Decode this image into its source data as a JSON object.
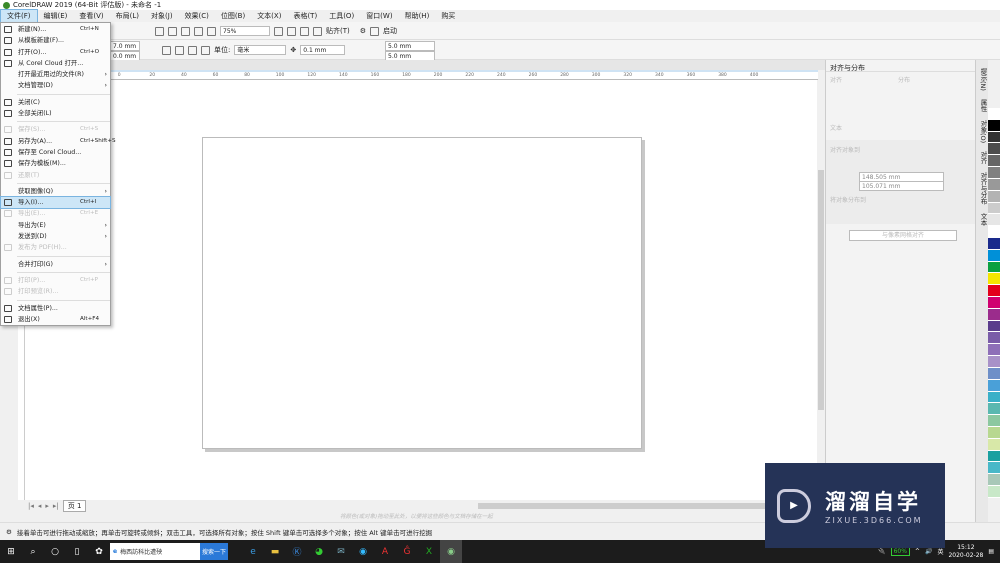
{
  "window": {
    "title": "CorelDRAW 2019 (64-Bit 评估版) - 未命名 -1"
  },
  "menubar": [
    "文件(F)",
    "编辑(E)",
    "查看(V)",
    "布局(L)",
    "对象(J)",
    "效果(C)",
    "位图(B)",
    "文本(X)",
    "表格(T)",
    "工具(O)",
    "窗口(W)",
    "帮助(H)",
    "购买"
  ],
  "toolbar": {
    "zoom": "75%",
    "snap": "贴齐(T)",
    "launch": "启动"
  },
  "propbar": {
    "width": "7.0 mm",
    "height": "0.0 mm",
    "unit_label": "单位:",
    "unit": "毫米",
    "nudge": "0.1 mm",
    "dup_x": "5.0 mm",
    "dup_y": "5.0 mm"
  },
  "ruler": [
    "-60",
    "-40",
    "-20",
    "0",
    "20",
    "40",
    "60",
    "80",
    "100",
    "120",
    "140",
    "160",
    "180",
    "200",
    "220",
    "240",
    "260",
    "280",
    "300",
    "320",
    "340",
    "360",
    "380",
    "400"
  ],
  "file_menu": [
    {
      "label": "新建(N)...",
      "shortcut": "Ctrl+N",
      "icon": "new-document-icon"
    },
    {
      "label": "从模板新建(F)...",
      "icon": "new-from-template-icon"
    },
    {
      "label": "打开(O)...",
      "shortcut": "Ctrl+O",
      "icon": "open-folder-icon"
    },
    {
      "label": "从 Corel Cloud 打开...",
      "icon": "cloud-icon"
    },
    {
      "label": "打开最近用过的文件(R)",
      "submenu": true
    },
    {
      "label": "文档管理(D)",
      "submenu": true
    },
    {
      "sep": true
    },
    {
      "label": "关闭(C)",
      "icon": "close-document-icon"
    },
    {
      "label": "全部关闭(L)",
      "icon": "close-all-icon"
    },
    {
      "sep": true
    },
    {
      "label": "保存(S)...",
      "shortcut": "Ctrl+S",
      "disabled": true,
      "icon": "save-icon"
    },
    {
      "label": "另存为(A)...",
      "shortcut": "Ctrl+Shift+S",
      "icon": "save-as-icon"
    },
    {
      "label": "保存至 Corel Cloud...",
      "icon": "cloud-upload-icon"
    },
    {
      "label": "保存为模板(M)...",
      "icon": "save-template-icon"
    },
    {
      "label": "还原(T)",
      "disabled": true,
      "icon": "revert-icon"
    },
    {
      "sep": true
    },
    {
      "label": "获取图像(Q)",
      "submenu": true
    },
    {
      "label": "导入(I)...",
      "shortcut": "Ctrl+I",
      "highlighted": true,
      "icon": "import-icon"
    },
    {
      "label": "导出(E)...",
      "shortcut": "Ctrl+E",
      "disabled": true,
      "icon": "export-icon"
    },
    {
      "label": "导出为(E)",
      "submenu": true
    },
    {
      "label": "发送到(D)",
      "submenu": true
    },
    {
      "label": "发布为 PDF(H)...",
      "disabled": true,
      "icon": "pdf-icon"
    },
    {
      "sep": true
    },
    {
      "label": "合并打印(G)",
      "submenu": true
    },
    {
      "sep": true
    },
    {
      "label": "打印(P)...",
      "shortcut": "Ctrl+P",
      "disabled": true,
      "icon": "print-icon"
    },
    {
      "label": "打印预览(R)...",
      "disabled": true,
      "icon": "print-preview-icon"
    },
    {
      "sep": true
    },
    {
      "label": "文档属性(P)...",
      "icon": "document-properties-icon"
    },
    {
      "label": "退出(X)",
      "shortcut": "Alt+F4",
      "icon": "power-icon"
    }
  ],
  "pagenav": {
    "page_tab": "页 1"
  },
  "canvas_hint": "将颜色(或对象)拖动至此处，以便将这些颜色与文档存储在一起",
  "status": "接着单击可进行拖动或缩放；再单击可旋转或倾斜；双击工具，可选择所有对象；按住 Shift 键单击可选择多个对象；按住 Alt 键单击可进行挖掘",
  "docker": {
    "title": "对齐与分布",
    "align": "对齐",
    "distribute": "分布",
    "text": "文本",
    "align_to": "对齐对象到",
    "x": "148.505 mm",
    "y": "105.071 mm",
    "distribute_to": "将对象分布到",
    "button": "与像素网格对齐"
  },
  "vtabs": [
    "提示(N)",
    "属性",
    "对象(O)",
    "对齐",
    "对齐与分布",
    "文本"
  ],
  "palette": [
    "#ffffff",
    "#000000",
    "#333333",
    "#4d4d4d",
    "#666666",
    "#808080",
    "#999999",
    "#b3b3b3",
    "#cccccc",
    "#e6e6e6",
    "#ffffff",
    "#1a2a8c",
    "#0090d8",
    "#0aa040",
    "#f5e600",
    "#e3001b",
    "#d0006f",
    "#9b2c8c",
    "#5a3c8c",
    "#7a5ca8",
    "#8e6fb8",
    "#a891c8",
    "#6e8fc8",
    "#4aa0d8",
    "#3ab0c8",
    "#5ab8b0",
    "#8cc8a0",
    "#b8d890",
    "#d8e8a8",
    "#1aa0a0",
    "#48b8c8",
    "#a8c8b8",
    "#c8e8c8"
  ],
  "taskbar": {
    "search_text": "梅西訪科比遭殃",
    "search_button": "搜索一下",
    "battery": "60%",
    "ime": "英",
    "time": "15:12",
    "date": "2020-02-28"
  },
  "watermark": {
    "name": "溜溜自学",
    "url": "ZIXUE.3D66.COM"
  }
}
